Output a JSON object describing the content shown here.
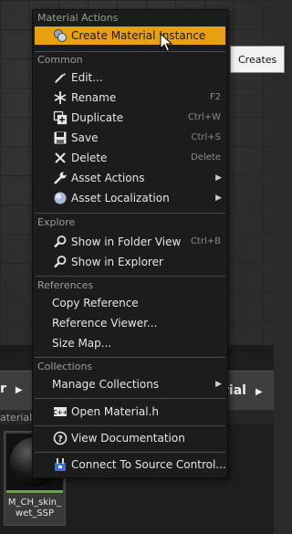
{
  "background": {
    "tooltip": "Creates"
  },
  "content_browser": {
    "crumb_left": "r",
    "crumb_right": "rial",
    "filter_label": "aterial",
    "asset": {
      "name_line1": "M_CH_skin_",
      "name_line2": "wet_SSP"
    }
  },
  "menu": {
    "sections": {
      "material_actions": "Material Actions",
      "common": "Common",
      "explore": "Explore",
      "references": "References",
      "collections": "Collections"
    },
    "items": {
      "create_material_instance": {
        "label": "Create Material Instance",
        "icon": "material-instance-icon"
      },
      "edit": {
        "label": "Edit...",
        "icon": "edit-icon"
      },
      "rename": {
        "label": "Rename",
        "shortcut": "F2",
        "icon": "rename-icon"
      },
      "duplicate": {
        "label": "Duplicate",
        "shortcut": "Ctrl+W",
        "icon": "duplicate-icon"
      },
      "save": {
        "label": "Save",
        "shortcut": "Ctrl+S",
        "icon": "save-icon"
      },
      "delete": {
        "label": "Delete",
        "shortcut": "Delete",
        "icon": "delete-icon"
      },
      "asset_actions": {
        "label": "Asset Actions",
        "icon": "wrench-icon"
      },
      "asset_localization": {
        "label": "Asset Localization",
        "icon": "globe-icon"
      },
      "show_in_folder_view": {
        "label": "Show in Folder View",
        "shortcut": "Ctrl+B",
        "icon": "magnifier-icon"
      },
      "show_in_explorer": {
        "label": "Show in Explorer",
        "icon": "magnifier-icon"
      },
      "copy_reference": {
        "label": "Copy Reference"
      },
      "reference_viewer": {
        "label": "Reference Viewer..."
      },
      "size_map": {
        "label": "Size Map..."
      },
      "manage_collections": {
        "label": "Manage Collections"
      },
      "open_material_h": {
        "label": "Open Material.h",
        "icon": "cpp-file-icon"
      },
      "view_documentation": {
        "label": "View Documentation",
        "icon": "help-icon"
      },
      "connect_to_source_control": {
        "label": "Connect To Source Control...",
        "icon": "source-control-icon"
      }
    }
  },
  "colors": {
    "highlight": "#e8a010",
    "menu_background": "#1c1c1c",
    "asset_type_bar": "#5fb030"
  }
}
